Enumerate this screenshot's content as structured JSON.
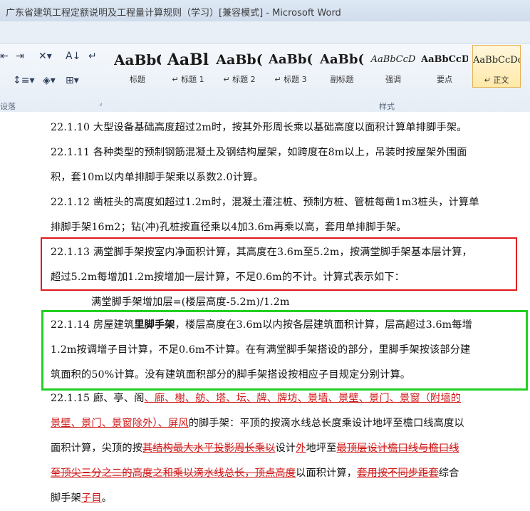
{
  "window": {
    "title": "广东省建筑工程定额说明及工程量计算规则（学习）[兼容模式] - Microsoft Word"
  },
  "ribbon": {
    "paragraph_group_label": "设落",
    "styles_group_label": "样式",
    "styles": [
      {
        "sample": "AaBbC(",
        "name": "标题"
      },
      {
        "sample": "AaBl",
        "name": "↵ 标题 1"
      },
      {
        "sample": "AaBb(",
        "name": "↵ 标题 2"
      },
      {
        "sample": "AaBb(",
        "name": "↵ 标题 3"
      },
      {
        "sample": "AaBb(",
        "name": "副标题"
      },
      {
        "sample": "AaBbCcD",
        "name": "强调"
      },
      {
        "sample": "AaBbCcD",
        "name": "要点"
      },
      {
        "sample": "AaBbCcDc",
        "name": "↵ 正文"
      }
    ],
    "active_style": "↵ 正文"
  },
  "document": {
    "p1": "22.1.10 大型设备基础高度超过2m时，按其外形周长乘以基础高度以面积计算单排脚手架。",
    "p2_l1": "22.1.11 各种类型的预制钢筋混凝土及钢结构屋架，如跨度在8m以上，吊装时按屋架外围面",
    "p2_l2": "积，套10m以内单排脚手架乘以系数2.0计算。",
    "p3_l1": "22.1.12 凿桩头的高度如超过1.2m时，混凝土灌注桩、预制方桩、管桩每凿1m3桩头，计算单",
    "p3_l2": "排脚手架16m2；钻(冲)孔桩按直径乘以4加3.6m再乘以高，套用单排脚手架。",
    "p4_l1": "22.1.13 满堂脚手架按室内净面积计算，其高度在3.6m至5.2m，按满堂脚手架基本层计算，",
    "p4_l2": "超过5.2m每增加1.2m按增加一层计算，不足0.6m的不计。计算式表示如下：",
    "p4_l3": "满堂脚手架增加层=(楼层高度-5.2m)/1.2m",
    "p5_l1a": "22.1.14 房屋建筑",
    "p5_l1b": "里脚手架",
    "p5_l1c": "，楼层高度在3.6m以内按各层建筑面积计算，层高超过3.6m每增",
    "p5_l2": "1.2m按调增子目计算，不足0.6m不计算。在有满堂脚手架搭设的部分，里脚手架按该部分建",
    "p5_l3": "筑面积的50%计算。没有建筑面积部分的脚手架搭设按相应子目规定分别计算。",
    "p6_l1a": "22.1.15 廊、亭、阁",
    "p6_l1b": "、廊、榭、舫、塔、坛、牌、牌坊、景墙、景壁、景门、景窗（附墙的",
    "p6_l2a": "景壁、景门、景窗除外）、屏风",
    "p6_l2b": "的脚手架：平顶的按滴水线总长度乘设计地坪至檐口线高度以",
    "p6_l3a": "面积计算，尖顶的按",
    "p6_l3b": "其结构最大水平投影周长乘以",
    "p6_l3c": "设计",
    "p6_l3d": "外",
    "p6_l3e": "地坪至",
    "p6_l3f": "最顶层设计檐口线与檐口线",
    "p6_l4a": "至顶尖三分之二的高度之和乘以滴水线总长，顶点高度",
    "p6_l4b": "以面积计算，",
    "p6_l4c": "套用按不同步距套",
    "p6_l4d": "综合",
    "p6_l5a": "脚手架",
    "p6_l5b": "子目",
    "p6_l5c": "。"
  }
}
